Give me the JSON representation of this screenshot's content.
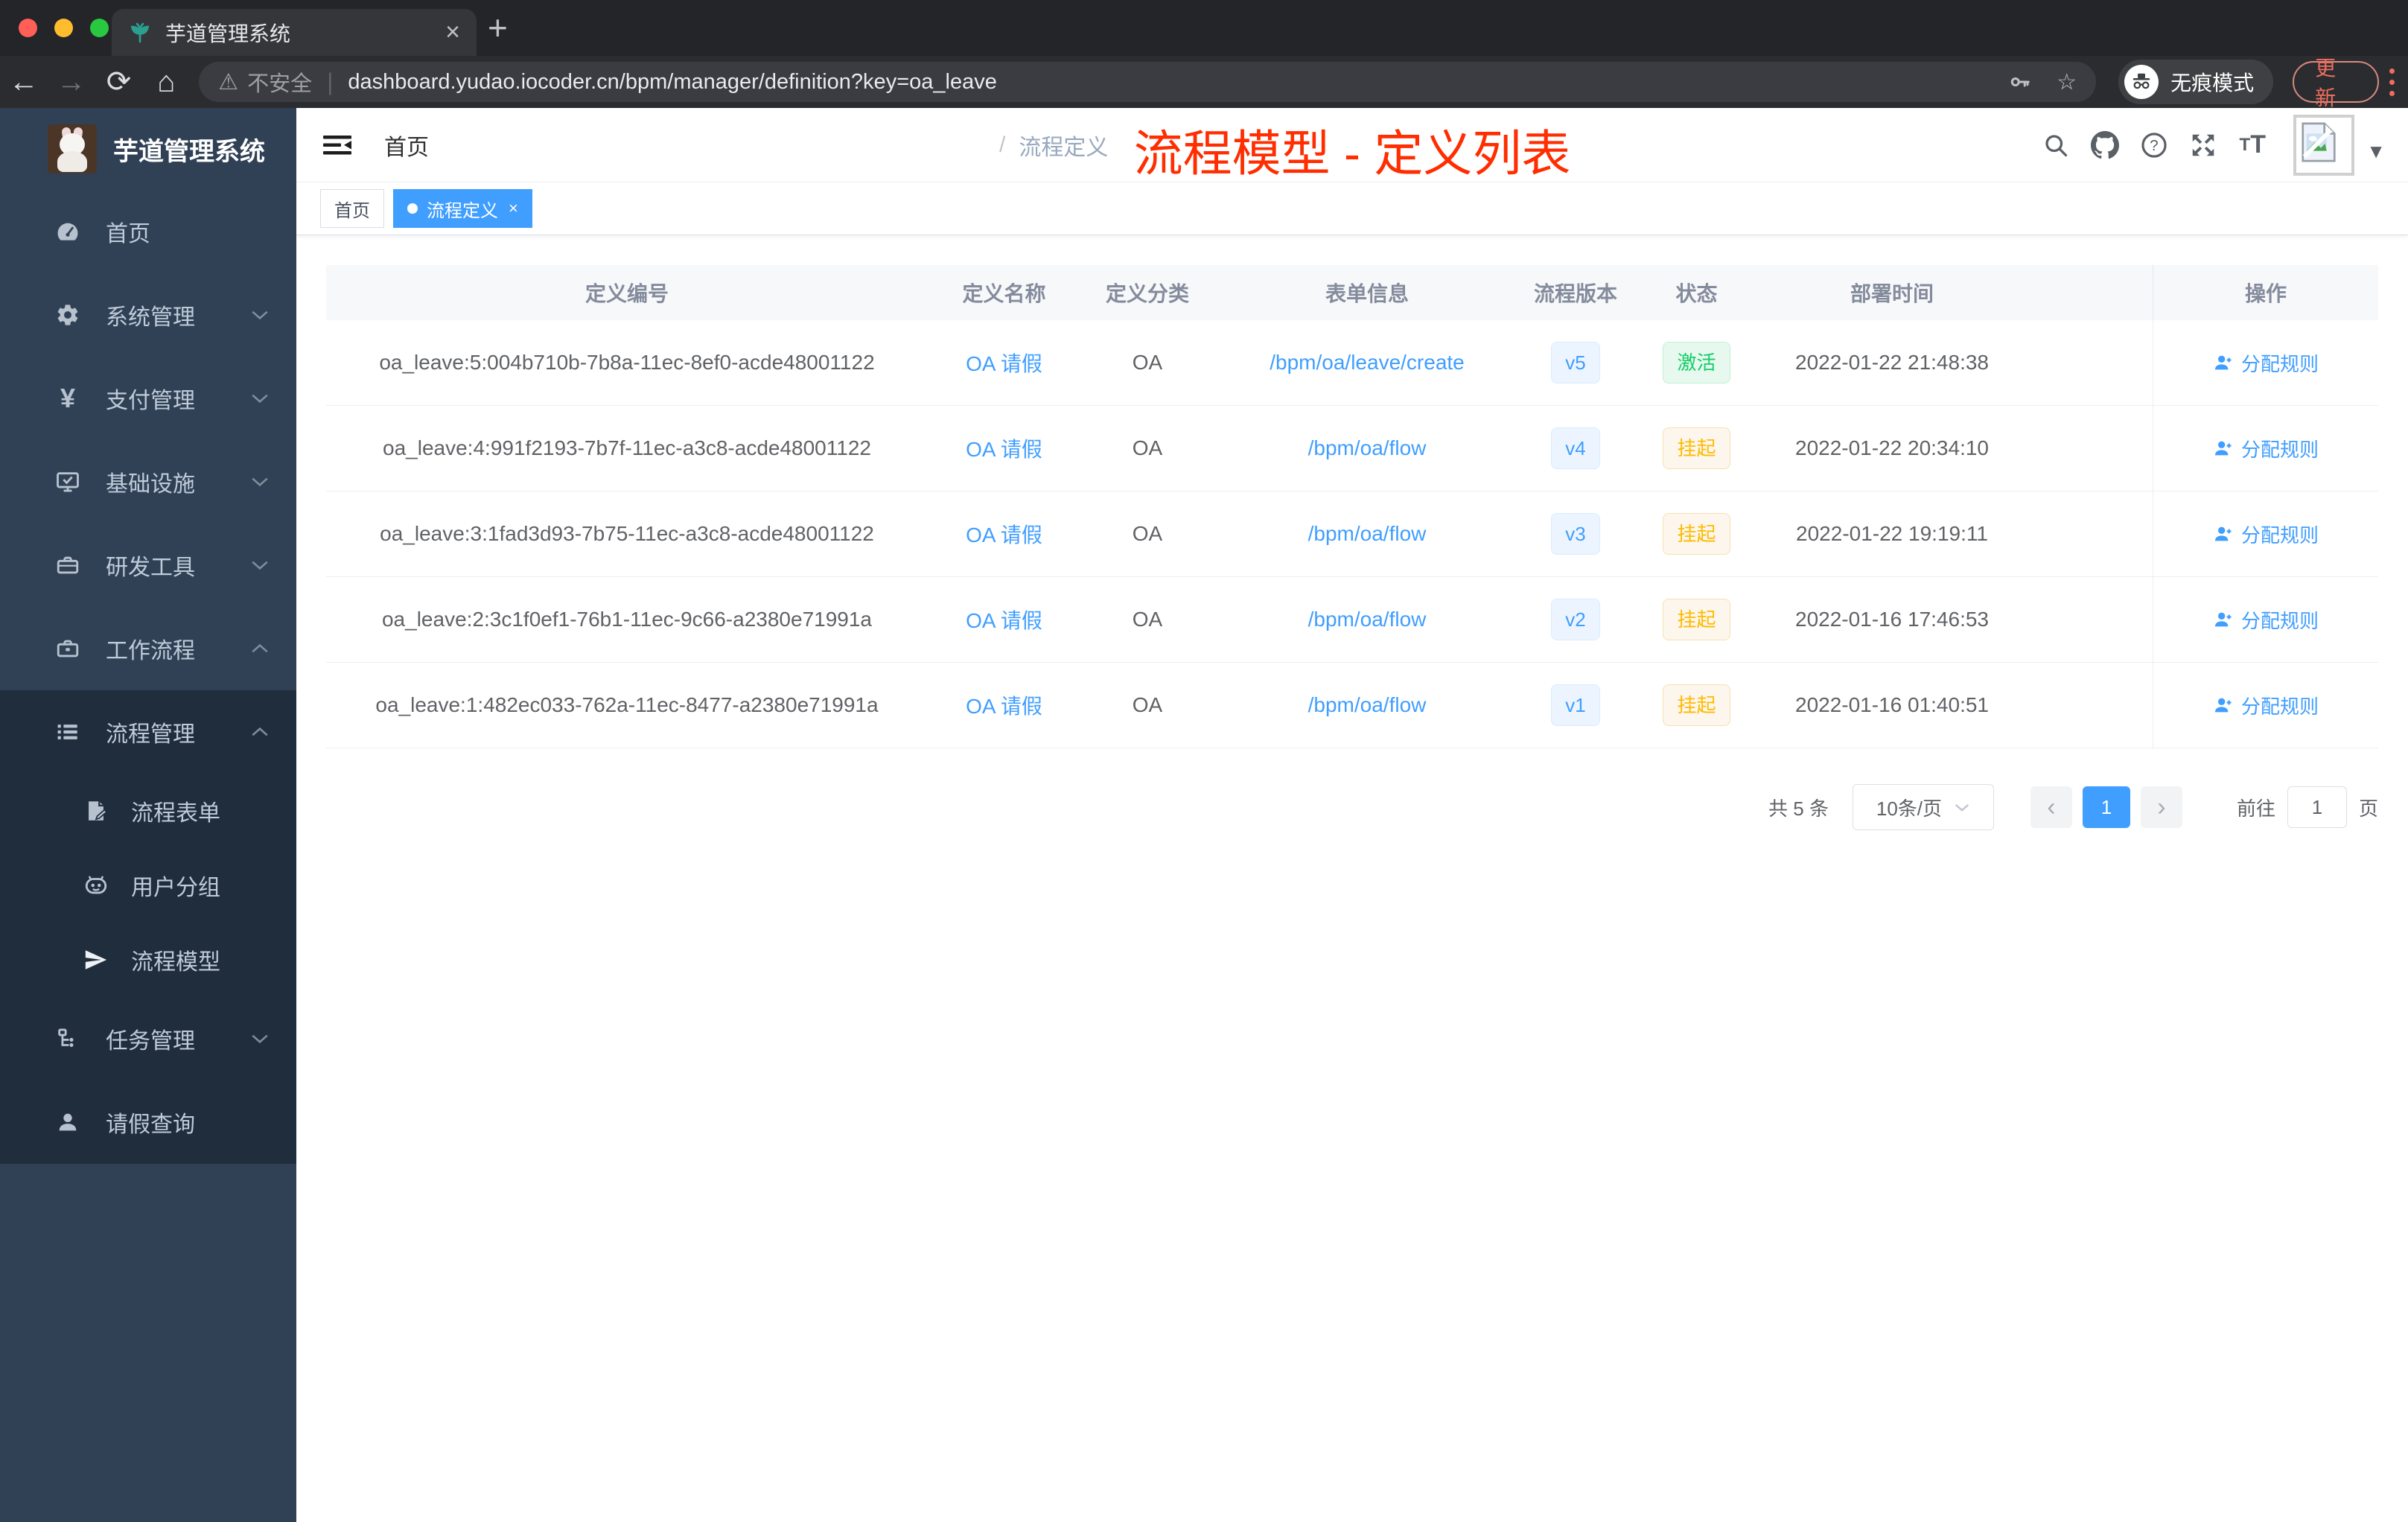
{
  "browser": {
    "tab_title": "芋道管理系统",
    "security_label": "不安全",
    "url": "dashboard.yudao.iocoder.cn/bpm/manager/definition?key=oa_leave",
    "incognito_label": "无痕模式",
    "update_label": "更新"
  },
  "glyphs": {
    "back": "←",
    "forward": "→",
    "reload": "⟳",
    "home": "⌂",
    "warning": "⚠",
    "divider": "|",
    "star": "☆",
    "close": "×",
    "plus": "+",
    "caret": "▼",
    "slash": "/",
    "dot_sep": "",
    "prev": "‹",
    "next": "›"
  },
  "sidebar": {
    "app_title": "芋道管理系统",
    "items": [
      {
        "label": "首页"
      },
      {
        "label": "系统管理"
      },
      {
        "label": "支付管理"
      },
      {
        "label": "基础设施"
      },
      {
        "label": "研发工具"
      },
      {
        "label": "工作流程"
      },
      {
        "label": "流程管理"
      },
      {
        "label": "流程表单"
      },
      {
        "label": "用户分组"
      },
      {
        "label": "流程模型"
      },
      {
        "label": "任务管理"
      },
      {
        "label": "请假查询"
      }
    ]
  },
  "header": {
    "breadcrumb": [
      "首页",
      "流程定义"
    ],
    "overlay_title": "流程模型 - 定义列表"
  },
  "tags": [
    {
      "label": "首页"
    },
    {
      "label": "流程定义"
    }
  ],
  "table": {
    "columns": [
      "定义编号",
      "定义名称",
      "定义分类",
      "表单信息",
      "流程版本",
      "状态",
      "部署时间",
      "操作"
    ],
    "rows": [
      {
        "id": "oa_leave:5:004b710b-7b8a-11ec-8ef0-acde48001122",
        "name": "OA 请假",
        "category": "OA",
        "form": "/bpm/oa/leave/create",
        "version": "v5",
        "status": "激活",
        "deploy_time": "2022-01-22 21:48:38",
        "action": "分配规则"
      },
      {
        "id": "oa_leave:4:991f2193-7b7f-11ec-a3c8-acde48001122",
        "name": "OA 请假",
        "category": "OA",
        "form": "/bpm/oa/flow",
        "version": "v4",
        "status": "挂起",
        "deploy_time": "2022-01-22 20:34:10",
        "action": "分配规则"
      },
      {
        "id": "oa_leave:3:1fad3d93-7b75-11ec-a3c8-acde48001122",
        "name": "OA 请假",
        "category": "OA",
        "form": "/bpm/oa/flow",
        "version": "v3",
        "status": "挂起",
        "deploy_time": "2022-01-22 19:19:11",
        "action": "分配规则"
      },
      {
        "id": "oa_leave:2:3c1f0ef1-76b1-11ec-9c66-a2380e71991a",
        "name": "OA 请假",
        "category": "OA",
        "form": "/bpm/oa/flow",
        "version": "v2",
        "status": "挂起",
        "deploy_time": "2022-01-16 17:46:53",
        "action": "分配规则"
      },
      {
        "id": "oa_leave:1:482ec033-762a-11ec-8477-a2380e71991a",
        "name": "OA 请假",
        "category": "OA",
        "form": "/bpm/oa/flow",
        "version": "v1",
        "status": "挂起",
        "deploy_time": "2022-01-16 01:40:51",
        "action": "分配规则"
      }
    ]
  },
  "pagination": {
    "total": "共 5 条",
    "page_size": "10条/页",
    "current_page": "1",
    "goto_label": "前往",
    "goto_value": "1",
    "page_label": "页"
  },
  "colors": {
    "accent": "#409eff",
    "success": "#13ce66",
    "warning": "#ffba00",
    "annotation": "#ff2d00",
    "sidebar_bg": "#304156",
    "submenu_bg": "#1f2d3d"
  }
}
